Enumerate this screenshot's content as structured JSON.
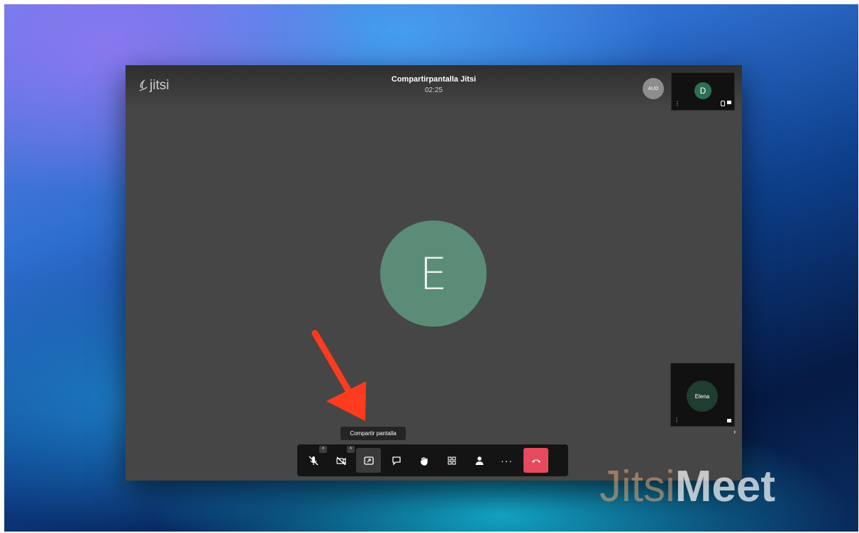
{
  "app": {
    "logo_text": "jitsi",
    "meeting_title": "Compartirpantalla Jitsi",
    "timer": "02:25"
  },
  "participants": {
    "audio_avatar_label": "AUD",
    "main_speaker_initial": "E",
    "thumbnail_top_initial": "D",
    "thumbnail_bottom_name": "Elena"
  },
  "toolbar": {
    "tooltip": "Compartir pantalla",
    "buttons": [
      {
        "name": "microphone",
        "icon": "mic-muted-icon",
        "has_caret": true
      },
      {
        "name": "camera",
        "icon": "camera-off-icon",
        "has_caret": true
      },
      {
        "name": "share-screen",
        "icon": "screen-share-icon",
        "active": true
      },
      {
        "name": "chat",
        "icon": "chat-icon"
      },
      {
        "name": "raise-hand",
        "icon": "hand-icon"
      },
      {
        "name": "tile-view",
        "icon": "grid-icon"
      },
      {
        "name": "participants",
        "icon": "person-icon"
      },
      {
        "name": "more",
        "icon": "more-icon"
      },
      {
        "name": "hangup",
        "icon": "phone-hangup-icon"
      }
    ],
    "more_label": "···",
    "caret_glyph": "^"
  },
  "watermark": {
    "part1": "Jitsi",
    "part2": "Meet"
  },
  "colors": {
    "window_bg": "#464646",
    "avatar_main": "#5b8c78",
    "hangup": "#e54b5f",
    "arrow": "#ff3b1f"
  }
}
